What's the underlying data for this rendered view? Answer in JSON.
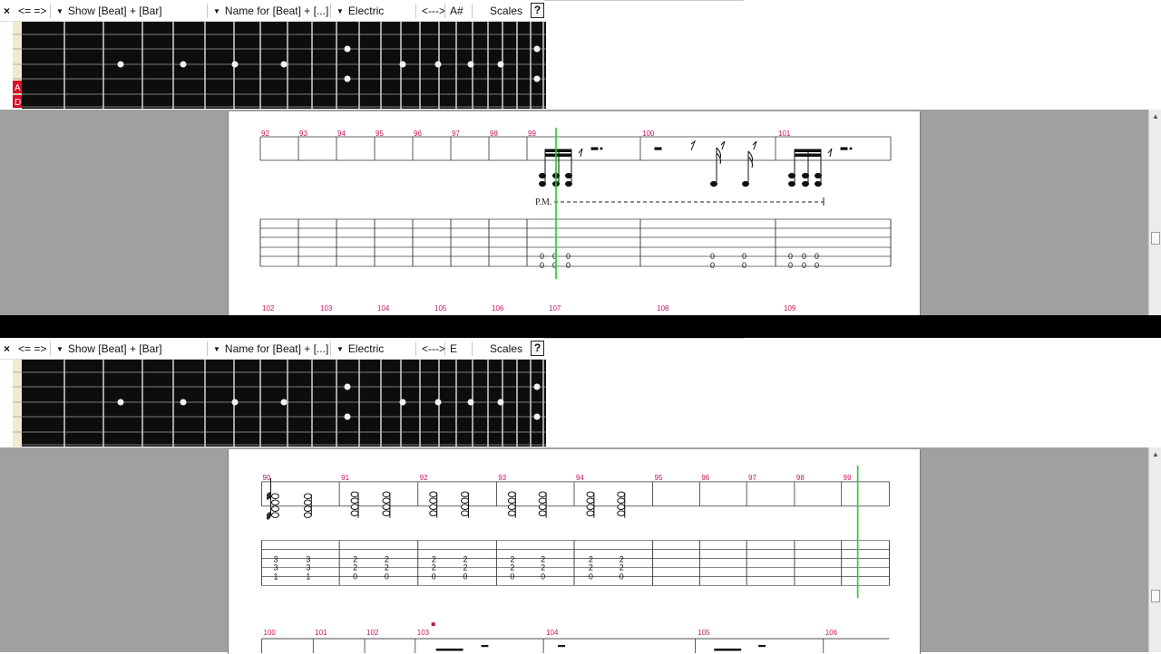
{
  "top": {
    "toolbar": {
      "close": "×",
      "nav": "<= =>",
      "show": "Show [Beat] + [Bar]",
      "name_for": "Name for [Beat] + [...]",
      "instrument": "Electric",
      "arrows": "<--->",
      "key": "A#",
      "scales": "Scales",
      "help": "?"
    },
    "string_labels": [
      "A",
      "D"
    ],
    "measures_row1": [
      "92",
      "93",
      "94",
      "95",
      "96",
      "97",
      "98",
      "99",
      "100",
      "101"
    ],
    "measures_row2": [
      "102",
      "103",
      "104",
      "105",
      "106",
      "107",
      "108",
      "109"
    ],
    "palm_mute": "P.M.",
    "tab_values": [
      "0",
      "0"
    ]
  },
  "bottom": {
    "toolbar": {
      "close": "×",
      "nav": "<= =>",
      "show": "Show [Beat] + [Bar]",
      "name_for": "Name for [Beat] + [...]",
      "instrument": "Electric",
      "arrows": "<--->",
      "key": "E",
      "scales": "Scales",
      "help": "?"
    },
    "measures_row1": [
      "90",
      "91",
      "92",
      "93",
      "94",
      "95",
      "96",
      "97",
      "98",
      "99"
    ],
    "measures_row2": [
      "100",
      "101",
      "102",
      "103",
      "104",
      "105",
      "106"
    ],
    "chord_a": [
      "3",
      "3",
      "1"
    ],
    "chord_b": [
      "2",
      "2",
      "0"
    ]
  },
  "colors": {
    "measure_number": "#c4185a",
    "cursor": "#22cc22",
    "fretboard": "#111111",
    "background": "#a0a0a0"
  }
}
